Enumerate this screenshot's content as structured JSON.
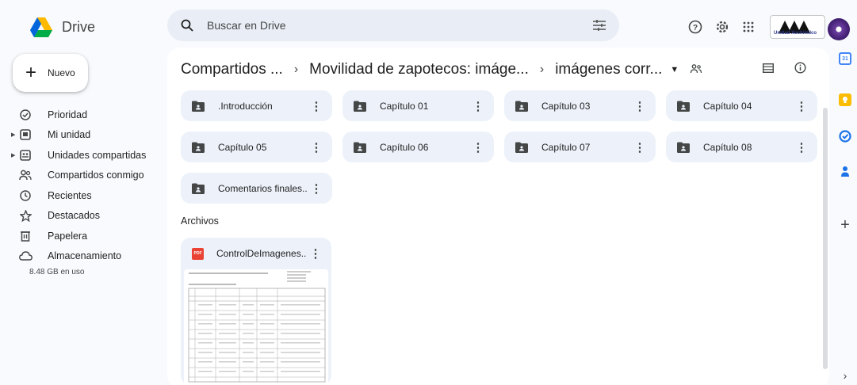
{
  "app": {
    "title": "Drive"
  },
  "search": {
    "placeholder": "Buscar en Drive"
  },
  "tenant": {
    "label": "Unidad Xochimilco"
  },
  "sidebar": {
    "new_label": "Nuevo",
    "items": [
      {
        "label": "Prioridad",
        "icon": "check-circle-icon",
        "caret": false
      },
      {
        "label": "Mi unidad",
        "icon": "my-drive-icon",
        "caret": true
      },
      {
        "label": "Unidades compartidas",
        "icon": "shared-drives-icon",
        "caret": true
      },
      {
        "label": "Compartidos conmigo",
        "icon": "people-icon",
        "caret": false
      },
      {
        "label": "Recientes",
        "icon": "clock-icon",
        "caret": false
      },
      {
        "label": "Destacados",
        "icon": "star-icon",
        "caret": false
      },
      {
        "label": "Papelera",
        "icon": "trash-icon",
        "caret": false
      },
      {
        "label": "Almacenamiento",
        "icon": "cloud-icon",
        "caret": false
      }
    ],
    "storage_text": "8.48 GB en uso"
  },
  "breadcrumb": {
    "items": [
      "Compartidos ...",
      "Movilidad de zapotecos: imáge...",
      "imágenes corr..."
    ],
    "separator": "›"
  },
  "folders": [
    {
      "name": ".Introducción"
    },
    {
      "name": "Capítulo 01"
    },
    {
      "name": "Capítulo 03"
    },
    {
      "name": "Capítulo 04"
    },
    {
      "name": "Capítulo 05"
    },
    {
      "name": "Capítulo 06"
    },
    {
      "name": "Capítulo 07"
    },
    {
      "name": "Capítulo 08"
    },
    {
      "name": "Comentarios finales..."
    }
  ],
  "files_section": {
    "label": "Archivos",
    "files": [
      {
        "name": "ControlDeImagenes...",
        "type_badge": "PDF"
      }
    ]
  },
  "colors": {
    "background": "#f8fafd",
    "search_bg": "#e9eef6",
    "folder_bg": "#edf2fa",
    "pdf_red": "#ea4335",
    "icon_grey": "#444746"
  },
  "right_rail": {
    "icons": [
      "calendar-icon",
      "keep-icon",
      "tasks-icon",
      "contacts-icon",
      "add-icon",
      "expand-icon"
    ],
    "calendar_day": "31"
  }
}
